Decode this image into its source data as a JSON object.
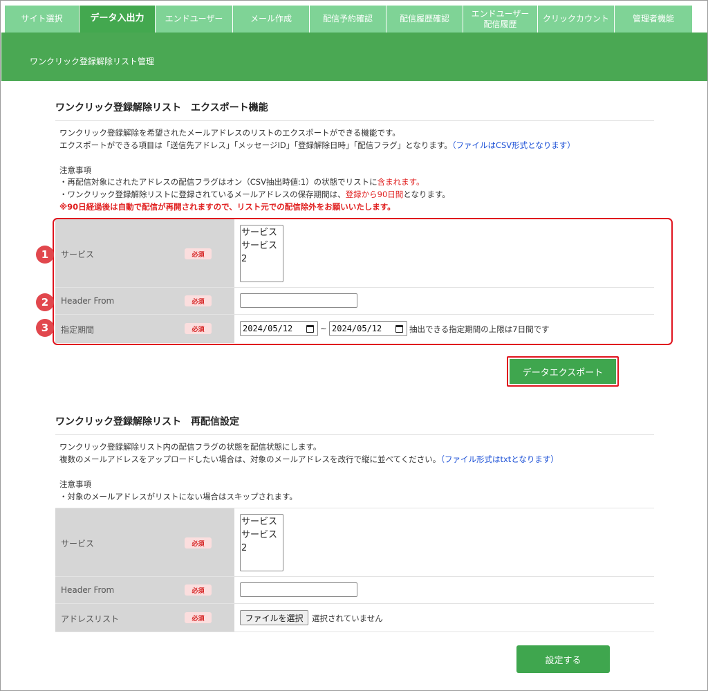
{
  "tabs": [
    {
      "label": "サイト選択",
      "active": false
    },
    {
      "label": "データ入出力",
      "active": true
    },
    {
      "label": "エンドユーザー",
      "active": false
    },
    {
      "label": "メール作成",
      "active": false
    },
    {
      "label": "配信予約確認",
      "active": false
    },
    {
      "label": "配信履歴確認",
      "active": false
    },
    {
      "label": "エンドユーザー",
      "label2": "配信履歴",
      "active": false
    },
    {
      "label": "クリックカウント",
      "active": false
    },
    {
      "label": "管理者機能",
      "active": false
    }
  ],
  "header": {
    "title": "ワンクリック登録解除リスト管理"
  },
  "export": {
    "title": "ワンクリック登録解除リスト　エクスポート機能",
    "desc1": "ワンクリック登録解除を希望されたメールアドレスのリストのエクスポートができる機能です。",
    "desc2": "エクスポートができる項目は「送信先アドレス」「メッセージID」「登録解除日時」「配信フラグ」となります。",
    "desc2_note": "（ファイルはCSV形式となります）",
    "notes_heading": "注意事項",
    "note1_a": "・再配信対象にされたアドレスの配信フラグはオン（CSV抽出時値:1）の状態でリストに",
    "note1_b": "含まれます。",
    "note2_a": "・ワンクリック登録解除リストに登録されているメールアドレスの保存期間は、",
    "note2_b": "登録から90日間",
    "note2_c": "となります。",
    "note3": "※90日経過後は自動で配信が再開されますので、リスト元での配信除外をお願いいたします。",
    "fields": {
      "service_label": "サービス",
      "from_label": "Header From",
      "period_label": "指定期間",
      "required": "必須",
      "service_options": [
        "サービス",
        "サービス2"
      ],
      "from_value": "",
      "date_start": "2024/05/12",
      "date_end": "2024/05/12",
      "tilde": "~",
      "period_note": "抽出できる指定期間の上限は7日間です"
    },
    "badges": [
      "1",
      "2",
      "3"
    ],
    "button": "データエクスポート"
  },
  "resend": {
    "title": "ワンクリック登録解除リスト　再配信設定",
    "desc1": "ワンクリック登録解除リスト内の配信フラグの状態を配信状態にします。",
    "desc2": "複数のメールアドレスをアップロードしたい場合は、対象のメールアドレスを改行で縦に並べてください。",
    "desc2_note": "（ファイル形式はtxtとなります）",
    "notes_heading": "注意事項",
    "note1": "・対象のメールアドレスがリストにない場合はスキップされます。",
    "fields": {
      "service_label": "サービス",
      "from_label": "Header From",
      "list_label": "アドレスリスト",
      "required": "必須",
      "service_options": [
        "サービス",
        "サービス2"
      ],
      "from_value": "",
      "file_button": "ファイルを選択",
      "file_status": "選択されていません"
    },
    "button": "設定する"
  },
  "colors": {
    "tab": "#7fd396",
    "tab_active": "#43a84f",
    "header_bar": "#4aa853",
    "button": "#3fa64e",
    "highlight": "#e0141e"
  }
}
